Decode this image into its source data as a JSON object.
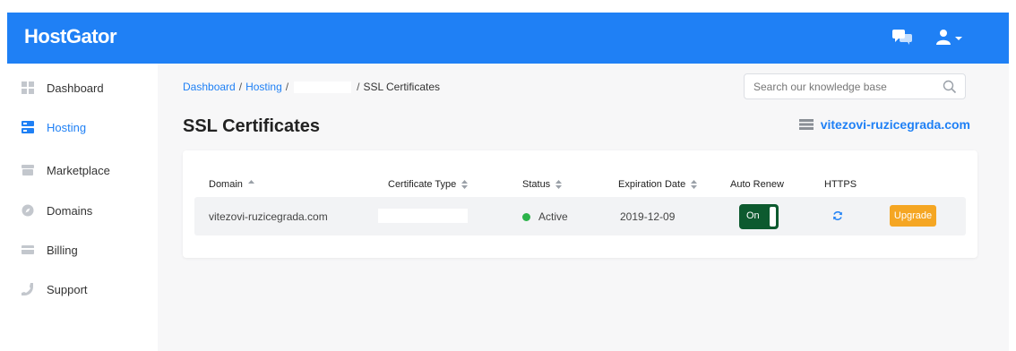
{
  "brand": {
    "logo_text": "HostGator",
    "accent_color": "#1f80f5"
  },
  "header": {
    "icons": [
      "chat-icon",
      "user-icon",
      "caret-down-icon"
    ]
  },
  "sidebar": {
    "items": [
      {
        "label": "Dashboard",
        "icon": "grid-icon",
        "active": false
      },
      {
        "label": "Hosting",
        "icon": "server-icon",
        "active": true
      },
      {
        "label": "Marketplace",
        "icon": "store-icon",
        "active": false
      },
      {
        "label": "Domains",
        "icon": "compass-icon",
        "active": false
      },
      {
        "label": "Billing",
        "icon": "credit-card-icon",
        "active": false
      },
      {
        "label": "Support",
        "icon": "phone-icon",
        "active": false
      }
    ]
  },
  "breadcrumb": {
    "dashboard": "Dashboard",
    "hosting": "Hosting",
    "separator": "/",
    "current": "SSL Certificates"
  },
  "search": {
    "placeholder": "Search our knowledge base",
    "value": ""
  },
  "page": {
    "title": "SSL Certificates",
    "site_name": "vitezovi-ruzicegrada.com"
  },
  "table": {
    "headers": {
      "domain": "Domain",
      "certificate_type": "Certificate Type",
      "status": "Status",
      "expiration_date": "Expiration Date",
      "auto_renew": "Auto Renew",
      "https": "HTTPS"
    },
    "rows": [
      {
        "domain": "vitezovi-ruzicegrada.com",
        "certificate_type": "",
        "status": "Active",
        "status_color": "#2cb34a",
        "expiration_date": "2019-12-09",
        "auto_renew_label": "On",
        "auto_renew": true,
        "https_icon": "refresh-icon",
        "action_label": "Upgrade",
        "action_color": "#f5a623"
      }
    ]
  }
}
